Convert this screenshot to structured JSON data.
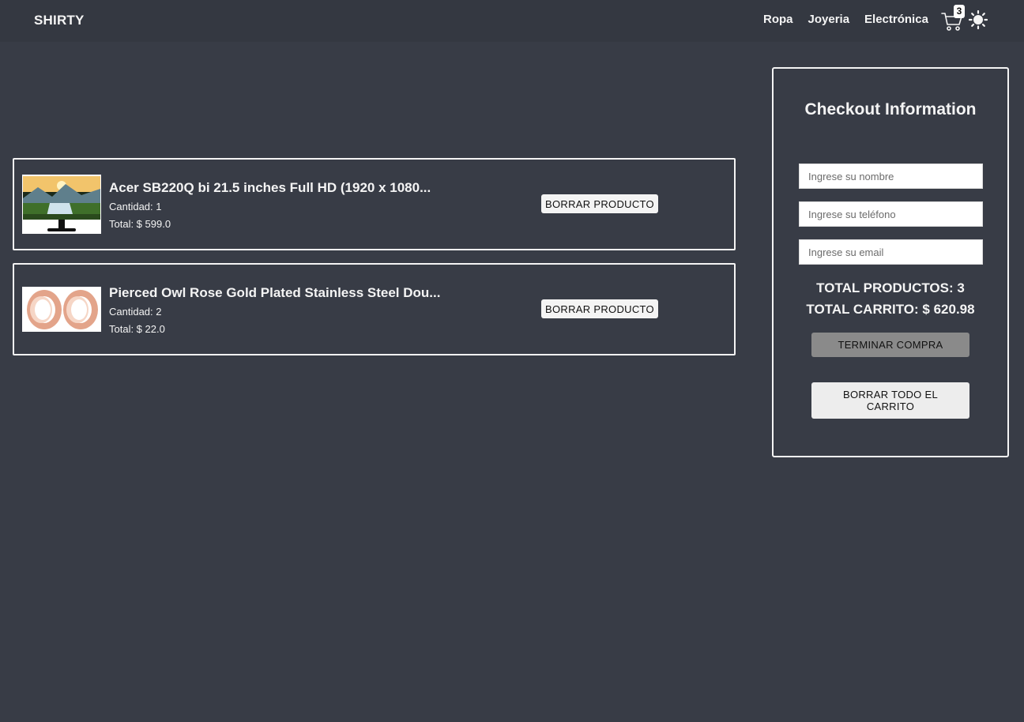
{
  "navbar": {
    "brand": "SHIRTY",
    "links": [
      "Ropa",
      "Joyeria",
      "Electrónica"
    ],
    "cart_count": "3",
    "cart_icon": "cart-icon",
    "theme_icon": "sun-icon"
  },
  "products": [
    {
      "title": "Acer SB220Q bi 21.5 inches Full HD (1920 x 1080...",
      "quantity": "Cantidad: 1",
      "total": "Total: $ 599.0",
      "delete_label": "BORRAR PRODUCTO",
      "image": "monitor-image"
    },
    {
      "title": "Pierced Owl Rose Gold Plated Stainless Steel Dou...",
      "quantity": "Cantidad: 2",
      "total": "Total: $ 22.0",
      "delete_label": "BORRAR PRODUCTO",
      "image": "rose-gold-earrings-image"
    }
  ],
  "checkout": {
    "title": "Checkout Information",
    "name_placeholder": "Ingrese su nombre",
    "phone_placeholder": "Ingrese su teléfono",
    "email_placeholder": "Ingrese su email",
    "total_products": "TOTAL PRODUCTOS: 3",
    "total_cart": "TOTAL CARRITO: $ 620.98",
    "finish_label": "TERMINAR COMPRA",
    "clear_label": "BORRAR TODO EL CARRITO"
  },
  "colors": {
    "background": "#383c46",
    "navbar": "#343841",
    "finish_button": "#8a8a8a"
  }
}
